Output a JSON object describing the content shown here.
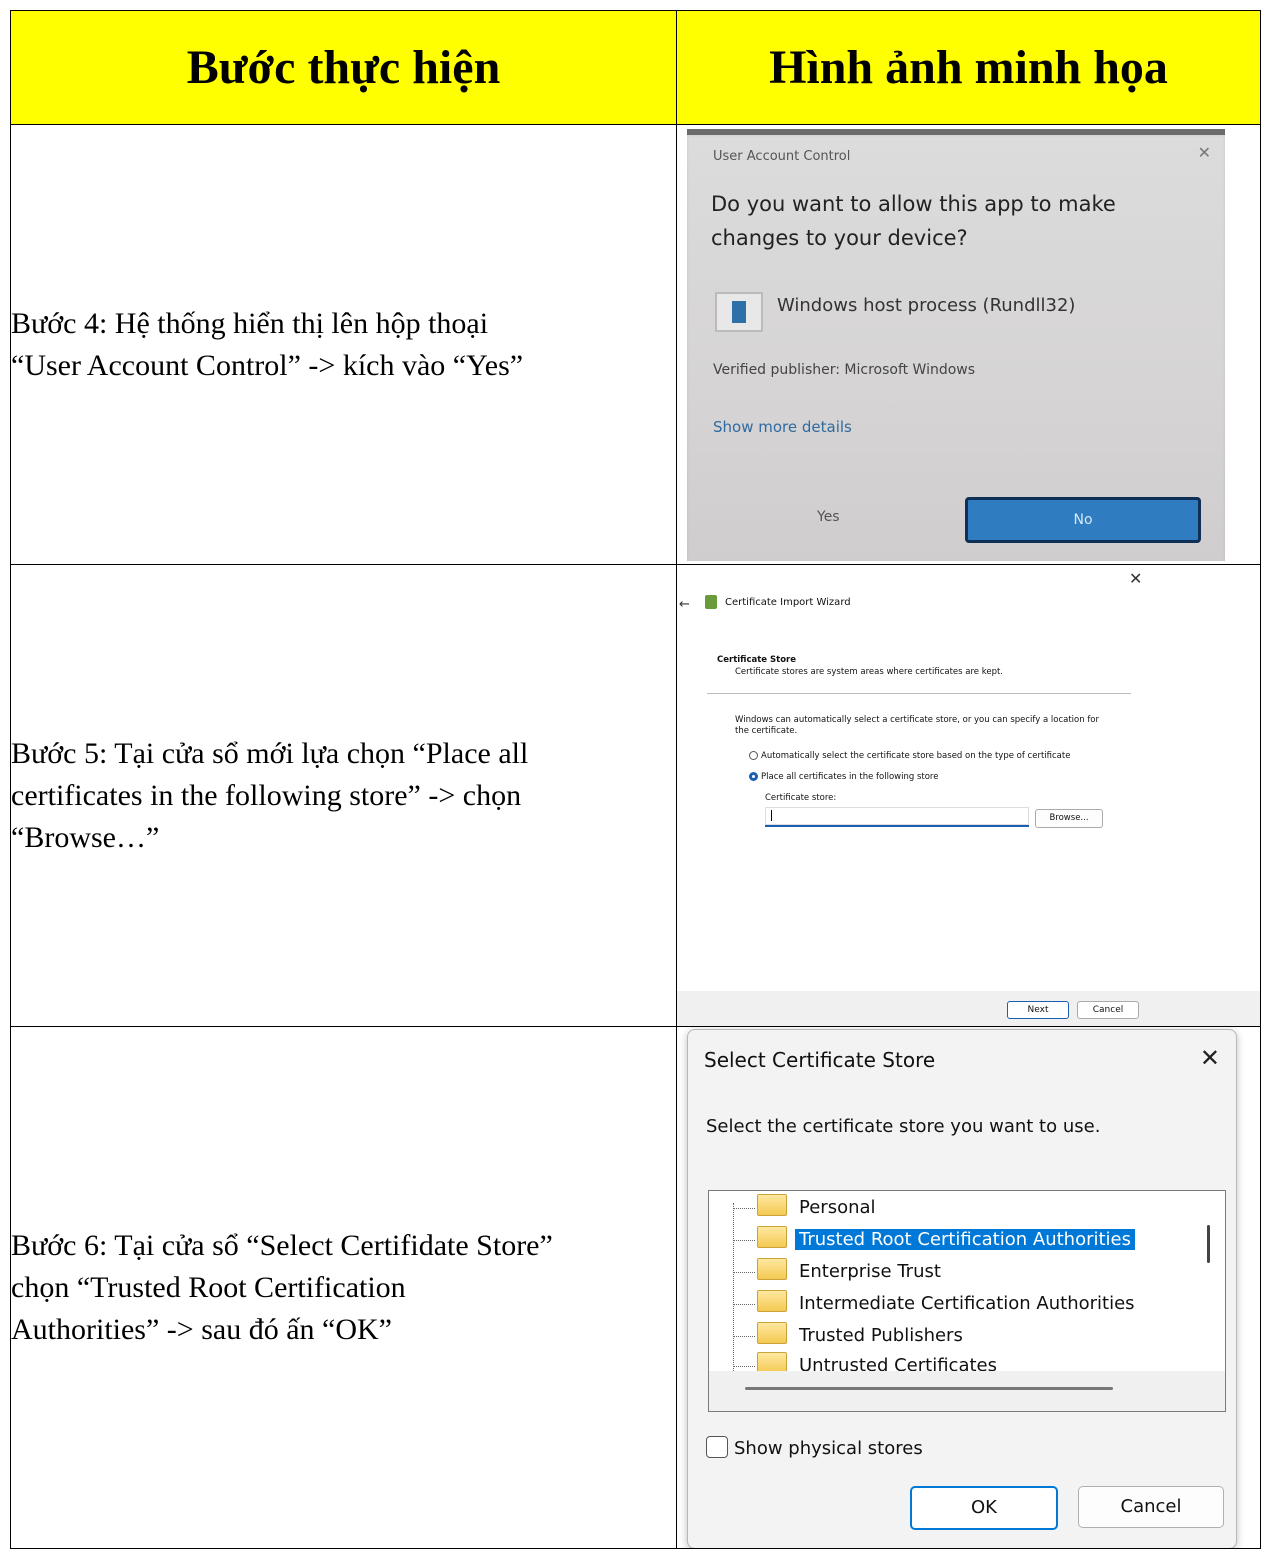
{
  "header": {
    "col_steps": "Bước thực hiện",
    "col_images": "Hình ảnh minh họa"
  },
  "rows": [
    {
      "step_line1": "Bước 4: Hệ thống hiển thị lên hộp thoại",
      "step_line2": "“User Account Control” -> kích vào “Yes”"
    },
    {
      "step_line1": "Bước 5: Tại cửa sổ mới lựa chọn “Place all",
      "step_line2": "certificates in the following store” -> chọn",
      "step_line3": "“Browse…”"
    },
    {
      "step_line1": "Bước 6: Tại cửa sổ “Select Certifidate Store”",
      "step_line2": "chọn “Trusted Root Certification",
      "step_line3": "Authorities” -> sau đó ấn “OK”"
    }
  ],
  "uac": {
    "title": "User Account Control",
    "question": "Do you want to allow this app to make changes to your device?",
    "app_name": "Windows host process (Rundll32)",
    "publisher": "Verified publisher: Microsoft Windows",
    "more_details": "Show more details",
    "yes": "Yes",
    "no": "No",
    "accent": "#2f7cc0"
  },
  "wizard": {
    "title": "Certificate Import Wizard",
    "section": "Certificate Store",
    "section_desc": "Certificate stores are system areas where certificates are kept.",
    "intro": "Windows can automatically select a certificate store, or you can specify a location for the certificate.",
    "option_auto": "Automatically select the certificate store based on the type of certificate",
    "option_place": "Place all certificates in the following store",
    "store_label": "Certificate store:",
    "store_value": "",
    "browse": "Browse...",
    "next": "Next",
    "cancel": "Cancel"
  },
  "select_store": {
    "title": "Select Certificate Store",
    "prompt": "Select the certificate store you want to use.",
    "items": [
      "Personal",
      "Trusted Root Certification Authorities",
      "Enterprise Trust",
      "Intermediate Certification Authorities",
      "Trusted Publishers",
      "Untrusted Certificates"
    ],
    "selected_index": 1,
    "show_physical": "Show physical stores",
    "ok": "OK",
    "cancel": "Cancel",
    "accent": "#0078d7"
  },
  "colors": {
    "header_bg": "#ffff00"
  }
}
